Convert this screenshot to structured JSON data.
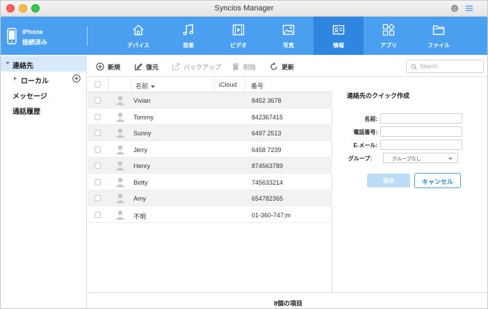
{
  "window": {
    "title": "Syncios Manager"
  },
  "device": {
    "name": "iPhone",
    "status": "接続済み"
  },
  "tabs": [
    {
      "label": "デバイス",
      "icon": "home-icon",
      "active": false
    },
    {
      "label": "音楽",
      "icon": "music-icon",
      "active": false
    },
    {
      "label": "ビデオ",
      "icon": "video-icon",
      "active": false
    },
    {
      "label": "写真",
      "icon": "photo-icon",
      "active": false
    },
    {
      "label": "情報",
      "icon": "contacts-card-icon",
      "active": true
    },
    {
      "label": "アプリ",
      "icon": "apps-icon",
      "active": false
    },
    {
      "label": "ファイル",
      "icon": "folder-icon",
      "active": false
    }
  ],
  "sidebar": {
    "items": [
      {
        "label": "連絡先"
      },
      {
        "label": "ローカル"
      },
      {
        "label": "メッセージ"
      },
      {
        "label": "通話履歴"
      }
    ]
  },
  "toolbar": {
    "new_label": "新規",
    "restore_label": "復元",
    "backup_label": "バックアップ",
    "delete_label": "削除",
    "refresh_label": "更新",
    "search_placeholder": "Search"
  },
  "table": {
    "columns": {
      "name": "名前",
      "icloud": "iCloud",
      "number": "番号"
    },
    "rows": [
      {
        "name": "Vivian",
        "number": "8452 3678"
      },
      {
        "name": "Tommy",
        "number": "842367415"
      },
      {
        "name": "Sunny",
        "number": "6497 2513"
      },
      {
        "name": "Jerry",
        "number": "6458 7239"
      },
      {
        "name": "Henry",
        "number": "874563789"
      },
      {
        "name": "Betty",
        "number": "745633214"
      },
      {
        "name": "Amy",
        "number": "654782365"
      },
      {
        "name": "不明",
        "number": "01-360-747;m"
      }
    ]
  },
  "status": {
    "count_text": "8個の項目"
  },
  "quick_create": {
    "title": "連絡先のクイック作成",
    "name_label": "名前:",
    "phone_label": "電話番号:",
    "email_label": "E-メール:",
    "group_label": "グループ:",
    "group_value": "グループなし",
    "save_label": "保存",
    "cancel_label": "キャンセル"
  },
  "colors": {
    "accent": "#4a9ff0",
    "active_tab": "#2f86e0",
    "sidebar_active": "#d6eafc"
  }
}
